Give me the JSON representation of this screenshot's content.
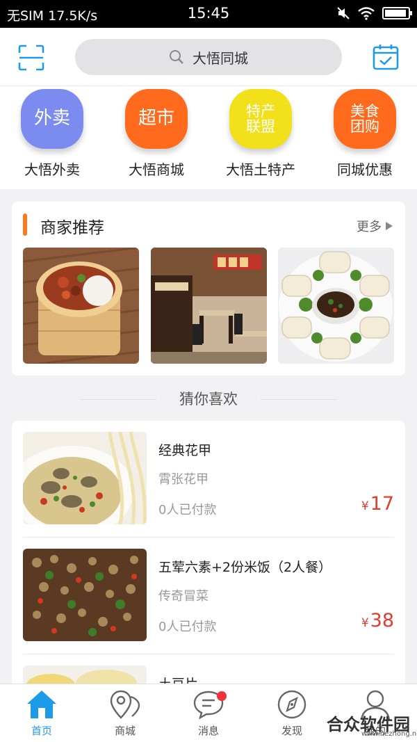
{
  "status": {
    "carrier": "无SIM",
    "speed": "17.5K/s",
    "time": "15:45",
    "battery_level": 0.95
  },
  "search": {
    "text": "大悟同城"
  },
  "categories": [
    {
      "tile": "外卖",
      "label": "大悟外卖",
      "color": "#7b8bf0"
    },
    {
      "tile": "超市",
      "label": "大悟商城",
      "color": "#ff6a1c"
    },
    {
      "tile": "特产\n联盟",
      "label": "大悟土特产",
      "color": "#f2e01a"
    },
    {
      "tile": "美食\n团购",
      "label": "同城优惠",
      "color": "#ff6a1c"
    }
  ],
  "merchants": {
    "title": "商家推荐",
    "more": "更多"
  },
  "guess": {
    "title": "猜你喜欢"
  },
  "items": [
    {
      "name": "经典花甲",
      "shop": "霄张花甲",
      "paid": "0人已付款",
      "currency": "¥",
      "price": "17"
    },
    {
      "name": "五荤六素+2份米饭（2人餐）",
      "shop": "传奇冒菜",
      "paid": "0人已付款",
      "currency": "¥",
      "price": "38"
    },
    {
      "name": "土豆片",
      "shop": "",
      "paid": "",
      "currency": "",
      "price": ""
    }
  ],
  "tabs": [
    {
      "label": "首页",
      "active": true
    },
    {
      "label": "商城"
    },
    {
      "label": "消息"
    },
    {
      "label": "发现"
    },
    {
      "label": "我的"
    }
  ],
  "watermark": {
    "text": "合众软件园",
    "url": "www.hezhong.net"
  },
  "colors": {
    "accent": "#1e9be8",
    "price": "#e33c2e",
    "orange": "#ff7a1a"
  }
}
